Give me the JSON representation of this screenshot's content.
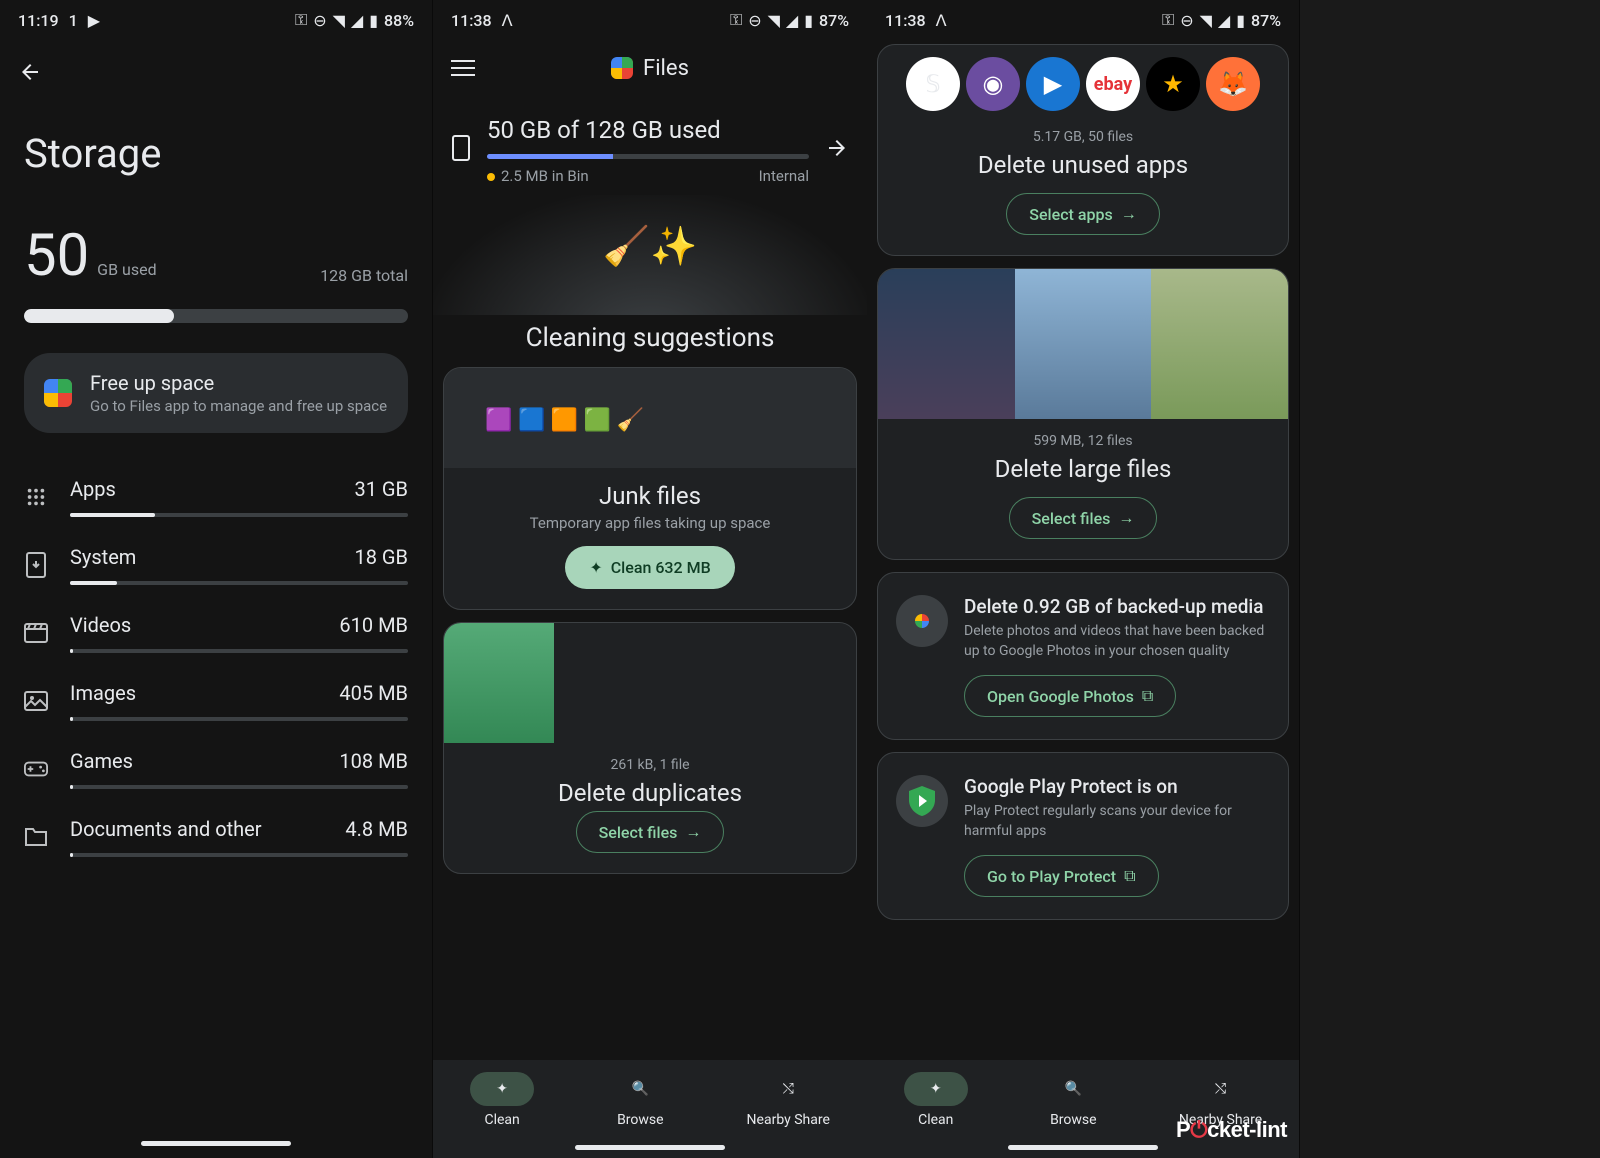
{
  "screen1": {
    "status": {
      "time": "11:19",
      "battery": "88%"
    },
    "title": "Storage",
    "used_value": "50",
    "used_label": "GB used",
    "total_label": "128 GB total",
    "bar_pct": 39,
    "freeup": {
      "title": "Free up space",
      "subtitle": "Go to Files app to manage and free up space"
    },
    "categories": [
      {
        "name": "Apps",
        "size": "31 GB",
        "pct": 25,
        "icon": "apps"
      },
      {
        "name": "System",
        "size": "18 GB",
        "pct": 14,
        "icon": "system"
      },
      {
        "name": "Videos",
        "size": "610 MB",
        "pct": 1,
        "icon": "movie"
      },
      {
        "name": "Images",
        "size": "405 MB",
        "pct": 1,
        "icon": "image"
      },
      {
        "name": "Games",
        "size": "108 MB",
        "pct": 1,
        "icon": "games"
      },
      {
        "name": "Documents and other",
        "size": "4.8 MB",
        "pct": 1,
        "icon": "folder"
      }
    ]
  },
  "screen2": {
    "status": {
      "time": "11:38",
      "battery": "87%"
    },
    "app_title": "Files",
    "summary": {
      "text": "50 GB of 128 GB used",
      "bar_pct": 39,
      "bin": "2.5 MB in Bin",
      "location": "Internal"
    },
    "cleaning_title": "Cleaning suggestions",
    "junk": {
      "title": "Junk files",
      "subtitle": "Temporary app files taking up space",
      "button": "Clean 632 MB"
    },
    "duplicates": {
      "info": "261 kB, 1 file",
      "title": "Delete duplicates",
      "button": "Select files"
    },
    "nav": {
      "clean": "Clean",
      "browse": "Browse",
      "share": "Nearby Share"
    }
  },
  "screen3": {
    "status": {
      "time": "11:38",
      "battery": "87%"
    },
    "unused_apps": {
      "info": "5.17 GB, 50 files",
      "title": "Delete unused apps",
      "button": "Select apps"
    },
    "large_files": {
      "info": "599 MB, 12 files",
      "title": "Delete large files",
      "button": "Select files"
    },
    "backed_up": {
      "title": "Delete 0.92 GB of backed-up media",
      "subtitle": "Delete photos and videos that have been backed up to Google Photos in your chosen quality",
      "button": "Open Google Photos"
    },
    "play_protect": {
      "title": "Google Play Protect is on",
      "subtitle": "Play Protect regularly scans your device for harmful apps",
      "button": "Go to Play Protect"
    },
    "nav": {
      "clean": "Clean",
      "browse": "Browse",
      "share": "Nearby Share"
    }
  },
  "watermark": "Pocket-lint"
}
